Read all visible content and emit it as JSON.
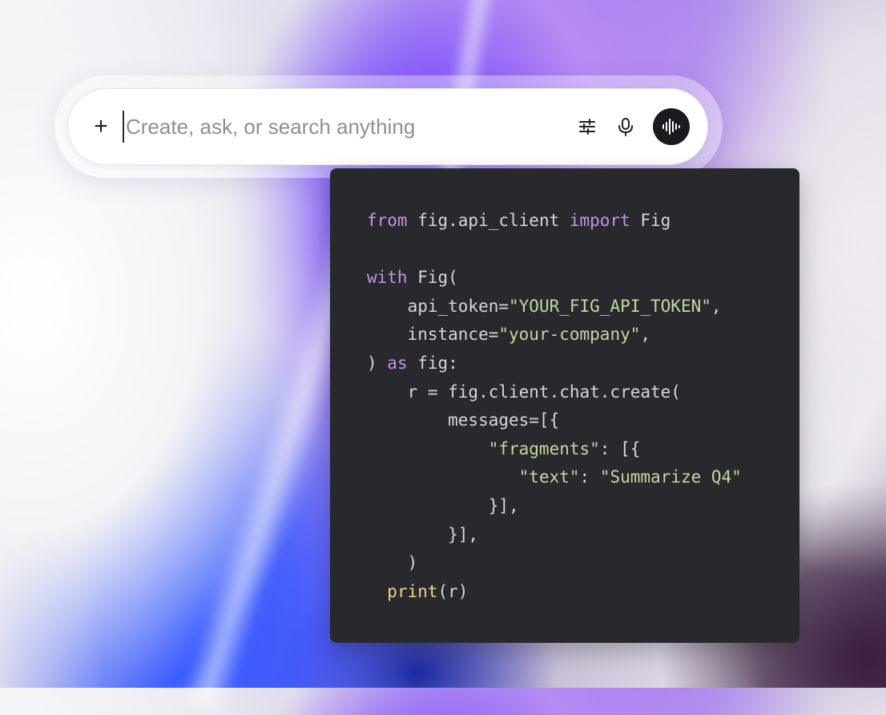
{
  "search": {
    "placeholder": "Create, ask, or search anything",
    "value": ""
  },
  "icons": {
    "add": "plus-icon",
    "settings": "sliders-icon",
    "mic": "microphone-icon",
    "voice": "waveform-icon"
  },
  "colors": {
    "code_bg": "#27292d",
    "keyword": "#c792ea",
    "string": "#c3d89c",
    "function": "#f0d28a",
    "text": "#d4d6da",
    "voice_button": "#1b1b1f"
  },
  "code": {
    "lines": [
      [
        {
          "t": "kw",
          "v": "from"
        },
        {
          "t": "tx",
          "v": " fig.api_client "
        },
        {
          "t": "kw",
          "v": "import"
        },
        {
          "t": "tx",
          "v": " Fig"
        }
      ],
      [],
      [
        {
          "t": "kw",
          "v": "with"
        },
        {
          "t": "tx",
          "v": " Fig("
        }
      ],
      [
        {
          "t": "tx",
          "v": "    api_token="
        },
        {
          "t": "str",
          "v": "\"YOUR_FIG_API_TOKEN\""
        },
        {
          "t": "tx",
          "v": ","
        }
      ],
      [
        {
          "t": "tx",
          "v": "    instance="
        },
        {
          "t": "str",
          "v": "\"your-company\""
        },
        {
          "t": "tx",
          "v": ","
        }
      ],
      [
        {
          "t": "tx",
          "v": ") "
        },
        {
          "t": "kw",
          "v": "as"
        },
        {
          "t": "tx",
          "v": " fig:"
        }
      ],
      [
        {
          "t": "tx",
          "v": "    r = fig.client.chat.create("
        }
      ],
      [
        {
          "t": "tx",
          "v": "        messages=[{"
        }
      ],
      [
        {
          "t": "tx",
          "v": "            "
        },
        {
          "t": "str",
          "v": "\"fragments\""
        },
        {
          "t": "tx",
          "v": ": [{"
        }
      ],
      [
        {
          "t": "tx",
          "v": "               "
        },
        {
          "t": "str",
          "v": "\"text\""
        },
        {
          "t": "tx",
          "v": ": "
        },
        {
          "t": "str",
          "v": "\"Summarize Q4\""
        }
      ],
      [
        {
          "t": "tx",
          "v": "            }],"
        }
      ],
      [
        {
          "t": "tx",
          "v": "        }],"
        }
      ],
      [
        {
          "t": "tx",
          "v": "    )"
        }
      ],
      [
        {
          "t": "tx",
          "v": "  "
        },
        {
          "t": "fn",
          "v": "print"
        },
        {
          "t": "tx",
          "v": "(r)"
        }
      ]
    ]
  }
}
